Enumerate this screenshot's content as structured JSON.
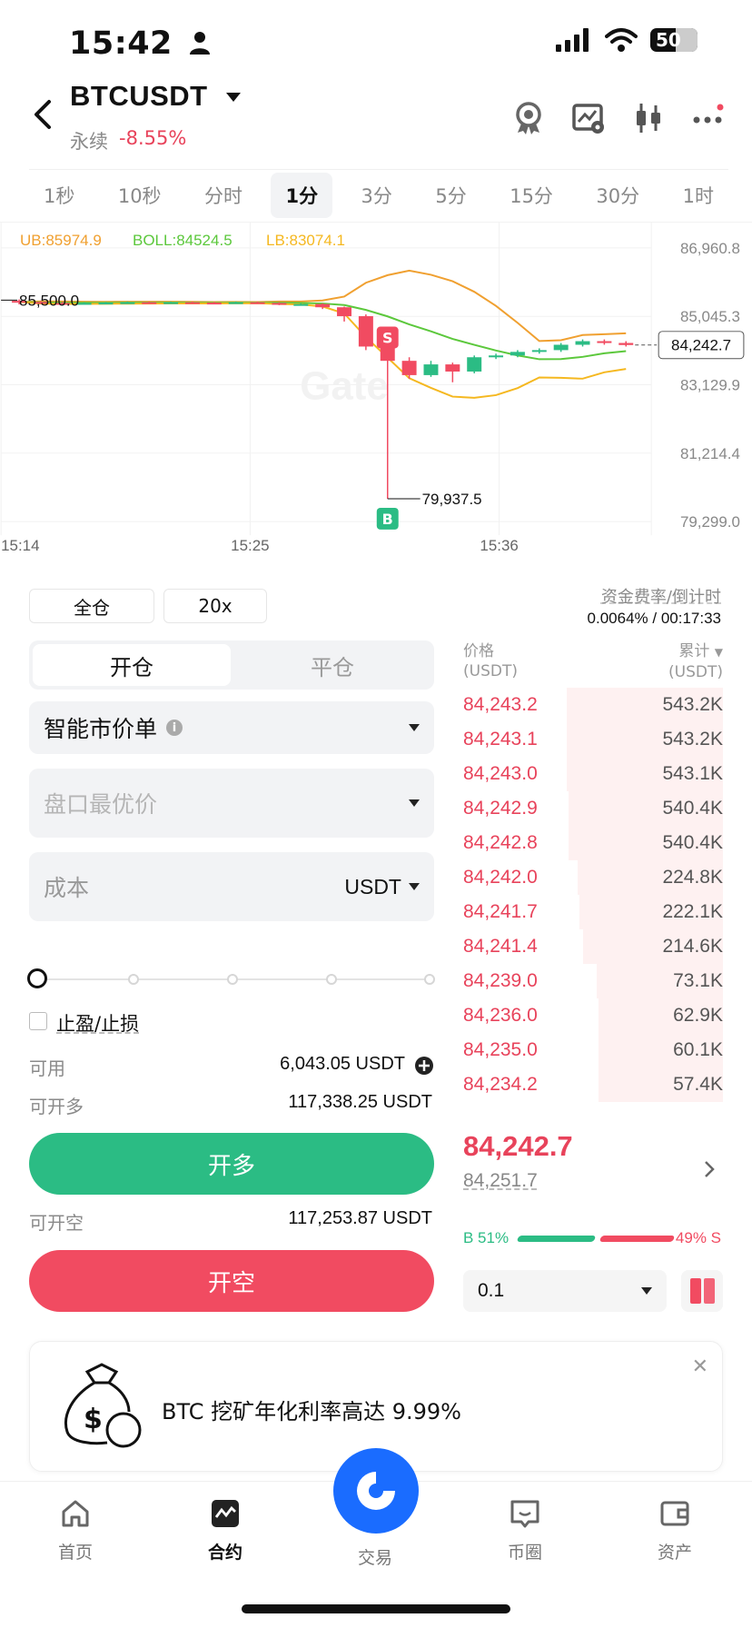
{
  "status_bar": {
    "time": "15:42",
    "battery": "50"
  },
  "header": {
    "pair": "BTCUSDT",
    "contract_type": "永续",
    "change": "-8.55%",
    "icons": [
      "award-icon",
      "chart-settings-icon",
      "candlestick-icon",
      "more-icon"
    ]
  },
  "intervals": {
    "items": [
      "1秒",
      "10秒",
      "分时",
      "1分",
      "3分",
      "5分",
      "15分",
      "30分",
      "1时"
    ],
    "active": "1分"
  },
  "chart_data": {
    "type": "candlestick",
    "indicators": {
      "ub": "UB:85974.9",
      "boll": "BOLL:84524.5",
      "lb": "LB:83074.1"
    },
    "y_ticks": [
      "86,960.8",
      "85,045.3",
      "83,129.9",
      "81,214.4",
      "79,299.0"
    ],
    "ylim": [
      79299.0,
      86960.8
    ],
    "x_ticks": [
      "15:14",
      "15:25",
      "15:36"
    ],
    "last_price": "84,242.7",
    "high_label": "85,500.0",
    "low_label": "79,937.5",
    "markers": {
      "sell": "S",
      "buy": "B"
    },
    "colors": {
      "up": "#2bbc84",
      "down": "#f14b61",
      "ub": "#f0a030",
      "boll": "#5cc83c",
      "lb": "#f5b820"
    },
    "candles": [
      [
        85480,
        85450,
        85380,
        85520
      ],
      [
        85450,
        85420,
        85390,
        85470
      ],
      [
        85420,
        85410,
        85380,
        85450
      ],
      [
        85400,
        85420,
        85380,
        85440
      ],
      [
        85410,
        85430,
        85390,
        85450
      ],
      [
        85420,
        85440,
        85400,
        85460
      ],
      [
        85440,
        85430,
        85400,
        85460
      ],
      [
        85430,
        85440,
        85410,
        85460
      ],
      [
        85440,
        85430,
        85410,
        85460
      ],
      [
        85430,
        85420,
        85400,
        85450
      ],
      [
        85420,
        85440,
        85400,
        85460
      ],
      [
        85440,
        85420,
        85400,
        85460
      ],
      [
        85420,
        85380,
        85360,
        85440
      ],
      [
        85380,
        85390,
        85360,
        85410
      ],
      [
        85390,
        85300,
        85250,
        85410
      ],
      [
        85300,
        85050,
        84900,
        85320
      ],
      [
        85050,
        84200,
        84100,
        85100
      ],
      [
        84200,
        83800,
        79937.5,
        84250
      ],
      [
        83800,
        83400,
        83300,
        83900
      ],
      [
        83400,
        83700,
        83350,
        83800
      ],
      [
        83700,
        83500,
        83200,
        83750
      ],
      [
        83500,
        83900,
        83450,
        83950
      ],
      [
        83900,
        83950,
        83850,
        84000
      ],
      [
        83950,
        84050,
        83900,
        84100
      ],
      [
        84050,
        84100,
        84000,
        84150
      ],
      [
        84100,
        84250,
        84050,
        84300
      ],
      [
        84250,
        84350,
        84200,
        84400
      ],
      [
        84350,
        84300,
        84250,
        84400
      ],
      [
        84300,
        84242.7,
        84200,
        84350
      ]
    ]
  },
  "leverage": {
    "margin_mode": "全仓",
    "multiplier": "20x"
  },
  "funding": {
    "label": "资金费率/倒计时",
    "value": "0.0064% / 00:17:33"
  },
  "order_form": {
    "tab_open": "开仓",
    "tab_close": "平仓",
    "order_type": "智能市价单",
    "price_placeholder": "盘口最优价",
    "amount_placeholder": "成本",
    "amount_unit": "USDT",
    "slider_percent": 0,
    "tp_sl": "止盈/止损",
    "available_label": "可用",
    "available_value": "6,043.05 USDT",
    "can_long_label": "可开多",
    "can_long_value": "117,338.25 USDT",
    "long_button": "开多",
    "can_short_label": "可开空",
    "can_short_value": "117,253.87 USDT",
    "short_button": "开空"
  },
  "order_book": {
    "price_header": "价格",
    "price_unit": "(USDT)",
    "total_header": "累计",
    "total_unit": "(USDT)",
    "asks": [
      {
        "price": "84,243.2",
        "total": "543.2K",
        "depth": 1.0
      },
      {
        "price": "84,243.1",
        "total": "543.2K",
        "depth": 1.0
      },
      {
        "price": "84,243.0",
        "total": "543.1K",
        "depth": 1.0
      },
      {
        "price": "84,242.9",
        "total": "540.4K",
        "depth": 0.99
      },
      {
        "price": "84,242.8",
        "total": "540.4K",
        "depth": 0.99
      },
      {
        "price": "84,242.0",
        "total": "224.8K",
        "depth": 0.93
      },
      {
        "price": "84,241.7",
        "total": "222.1K",
        "depth": 0.92
      },
      {
        "price": "84,241.4",
        "total": "214.6K",
        "depth": 0.9
      },
      {
        "price": "84,239.0",
        "total": "73.1K",
        "depth": 0.81
      },
      {
        "price": "84,236.0",
        "total": "62.9K",
        "depth": 0.8
      },
      {
        "price": "84,235.0",
        "total": "60.1K",
        "depth": 0.8
      },
      {
        "price": "84,234.2",
        "total": "57.4K",
        "depth": 0.8
      }
    ],
    "mark_price": "84,242.7",
    "index_price": "84,251.7",
    "buy_ratio_label": "B 51%",
    "sell_ratio_label": "49% S",
    "buy_ratio": 0.51,
    "depth_step": "0.1"
  },
  "promo": {
    "text": "BTC 挖矿年化利率高达 9.99%"
  },
  "bottom_nav": {
    "home": "首页",
    "futures": "合约",
    "trade": "交易",
    "community": "币圈",
    "assets": "资产"
  }
}
